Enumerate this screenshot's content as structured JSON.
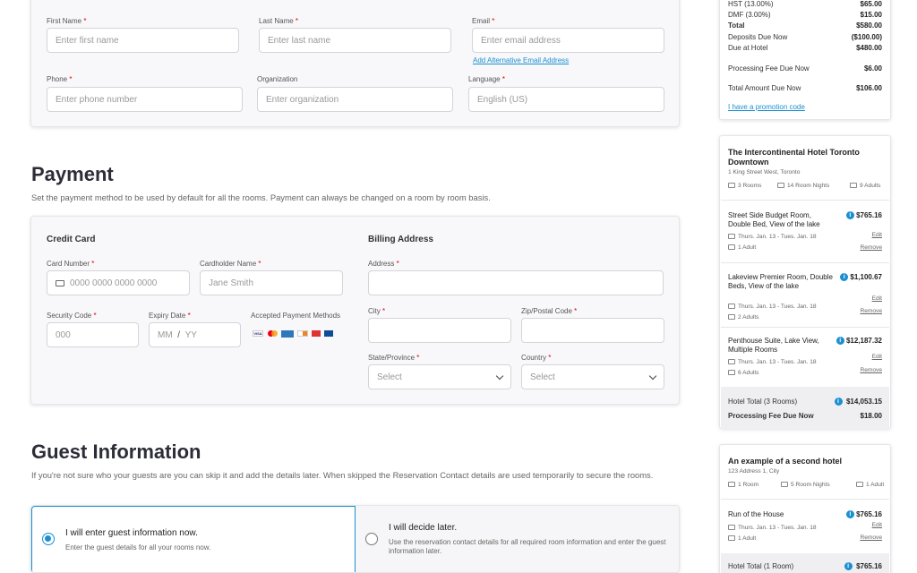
{
  "contact": {
    "first_name": {
      "label": "First Name",
      "placeholder": "Enter first name"
    },
    "last_name": {
      "label": "Last Name",
      "placeholder": "Enter last name"
    },
    "email": {
      "label": "Email",
      "placeholder": "Enter email address",
      "alt_link": "Add Alternative Email Address"
    },
    "phone": {
      "label": "Phone",
      "placeholder": "Enter phone number"
    },
    "organization": {
      "label": "Organization",
      "placeholder": "Enter organization"
    },
    "language": {
      "label": "Language",
      "value": "English (US)"
    }
  },
  "payment": {
    "title": "Payment",
    "description": "Set the payment method to be used by default for all the rooms. Payment can always be changed on a room by room basis.",
    "credit_card_title": "Credit Card",
    "card_number": {
      "label": "Card Number",
      "placeholder": "0000 0000 0000 0000"
    },
    "cardholder": {
      "label": "Cardholder Name",
      "placeholder": "Jane Smith"
    },
    "security_code": {
      "label": "Security Code",
      "placeholder": "000"
    },
    "expiry": {
      "label": "Expiry Date",
      "mm": "MM",
      "sep": "/",
      "yy": "YY"
    },
    "accepted_label": "Accepted Payment Methods",
    "billing_title": "Billing Address",
    "address": {
      "label": "Address"
    },
    "city": {
      "label": "City"
    },
    "zip": {
      "label": "Zip/Postal Code"
    },
    "state": {
      "label": "State/Province",
      "value": "Select"
    },
    "country": {
      "label": "Country",
      "value": "Select"
    }
  },
  "guest": {
    "title": "Guest Information",
    "description": "If you're not sure who your guests are you can skip it and add the details later. When skipped the Reservation Contact details are used temporarily to secure the rooms.",
    "option1": {
      "title": "I will enter guest information now.",
      "sub": "Enter the guest details for all your rooms now."
    },
    "option2": {
      "title": "I will decide later.",
      "sub": "Use the reservation contact details for all required room information and enter the guest information later."
    }
  },
  "summary": {
    "rows": [
      {
        "label": "HST (13.00%)",
        "value": "$65.00"
      },
      {
        "label": "DMF (3.00%)",
        "value": "$15.00"
      },
      {
        "label": "Total",
        "value": "$580.00"
      },
      {
        "label": "Deposits Due Now",
        "value": "($100.00)"
      },
      {
        "label": "Due at Hotel",
        "value": "$480.00"
      }
    ],
    "processing_label": "Processing Fee Due Now",
    "processing_value": "$6.00",
    "total_due_label": "Total Amount Due Now",
    "total_due_value": "$106.00",
    "promo_link": "I have a promotion code"
  },
  "hotel1": {
    "name": "The Intercontinental Hotel Toronto Downtown",
    "address": "1 King Street West, Toronto",
    "rooms": "3 Rooms",
    "nights": "14 Room Nights",
    "guests": "9 Adults",
    "room_list": [
      {
        "name": "Street Side Budget Room, Double Bed, View of the lake",
        "price": "$765.16",
        "dates": "Thurs. Jan. 13 - Tues. Jan. 18",
        "adults": "1 Adult"
      },
      {
        "name": "Lakeview Premier Room, Double Beds, View of the lake",
        "price": "$1,100.67",
        "dates": "Thurs. Jan. 13 - Tues. Jan. 18",
        "adults": "2 Adults"
      },
      {
        "name": "Penthouse Suite, Lake View, Multiple Rooms",
        "price": "$12,187.32",
        "dates": "Thurs. Jan. 13 - Tues. Jan. 18",
        "adults": "6 Adults"
      }
    ],
    "edit": "Edit",
    "remove": "Remove",
    "hotel_total_label": "Hotel Total (3 Rooms)",
    "hotel_total_value": "$14,053.15",
    "fee_label": "Processing Fee Due Now",
    "fee_value": "$18.00"
  },
  "hotel2": {
    "name": "An example of a second hotel",
    "address": "123 Address 1, City",
    "rooms": "1 Room",
    "nights": "5 Room Nights",
    "guests": "1 Adult",
    "room": {
      "name": "Run of the House",
      "price": "$765.16",
      "dates": "Thurs. Jan. 13 - Tues. Jan. 18",
      "adults": "1 Adult"
    },
    "edit": "Edit",
    "remove": "Remove",
    "hotel_total_label": "Hotel Total (1 Room)",
    "hotel_total_value": "$765.16"
  },
  "colors": {
    "accent": "#1a8fd1",
    "required": "#dd0000"
  }
}
